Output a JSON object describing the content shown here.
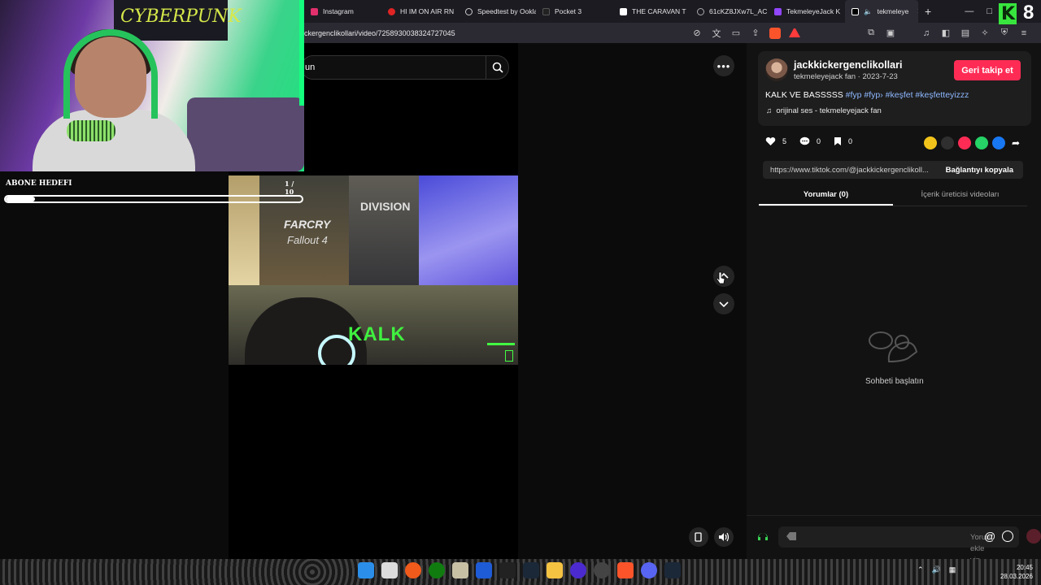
{
  "browser": {
    "tabs": [
      {
        "label": "Instagram",
        "color": "#e1306c"
      },
      {
        "label": "HI IM ON AIR RN",
        "color": "#e02424"
      },
      {
        "label": "Speedtest by Ookla",
        "color": "#cccccc"
      },
      {
        "label": "Pocket 3",
        "color": "#222222"
      },
      {
        "label": "THE CARAVAN T",
        "color": "#ffffff"
      },
      {
        "label": "61cKZ8JXw7L_AC",
        "color": "#aaaaaa"
      },
      {
        "label": "TekmeleyeJack K",
        "color": "#9146ff"
      },
      {
        "label": "tekmeleye",
        "color": "#ffffff",
        "active": true
      }
    ],
    "url": "ckergenclikollari/video/7258930038324727045",
    "new_tab": "+",
    "minimize": "—",
    "restore": "□",
    "close": "✕"
  },
  "overlay": {
    "poster_text": "CYBERPUNK",
    "goal_label": "ABONE HEDEFI",
    "goal_count": "1 / 10",
    "goal_fraction": 0.1
  },
  "search": {
    "value": "un"
  },
  "video": {
    "caption_word": "KALK",
    "poster1_title": "FARCRY",
    "poster1_sub": "Fallout 4",
    "poster2_title": "DIVISION"
  },
  "post": {
    "author": "jackkickergenclikollari",
    "meta": "tekmeleyejack fan · 2023-7-23",
    "follow_label": "Geri takip et",
    "description_text": "KALK VE BASSSSS",
    "description_tags": "#fyp #fyp› #keşfet #keşfetteyizzz",
    "sound": "orijinal ses - tekmeleyejack fan",
    "likes": "5",
    "comments": "0",
    "saves": "0",
    "link": "https://www.tiktok.com/@jackkickergenclikoll...",
    "copy_label": "Bağlantıyı kopyala",
    "tab_comments": "Yorumlar (0)",
    "tab_creator": "İçerik üreticisi videoları",
    "empty_text": "Sohbeti başlatın",
    "comment_placeholder": "Yorum ekle yin..."
  },
  "taskbar": {
    "time": "20:45",
    "date": "28.03.2026"
  },
  "corner": {
    "digit": "8"
  },
  "colors": {
    "accent": "#fe2c55",
    "tag": "#8eb8ff",
    "overlay_green": "#38e53e"
  }
}
